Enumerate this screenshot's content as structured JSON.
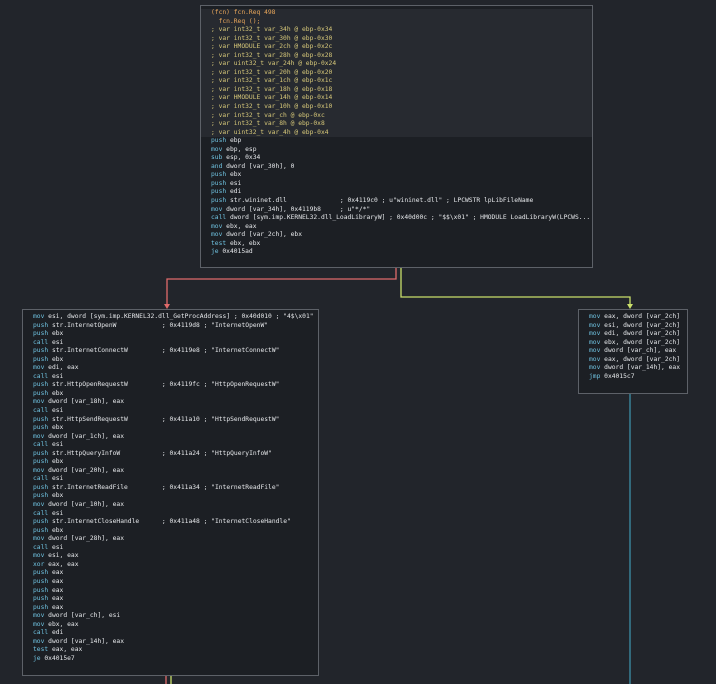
{
  "colors": {
    "true_edge": "#c9df6a",
    "false_edge": "#e06b6b",
    "jump_edge": "#3d8fa8",
    "mnemonic": "#6fc2e0",
    "function_header": "#e8a65a"
  },
  "nodes": {
    "entry": {
      "lines": [
        {
          "t": "(fcn) fcn.Req 498",
          "c": "fn",
          "h": 1
        },
        {
          "t": "  fcn.Req ();",
          "c": "fn",
          "h": 1
        },
        {
          "t": "; var int32_t var_34h @ ebp-0x34",
          "c": "vr",
          "h": 1
        },
        {
          "t": "; var int32_t var_30h @ ebp-0x30",
          "c": "vr",
          "h": 1
        },
        {
          "t": "; var HMODULE var_2ch @ ebp-0x2c",
          "c": "vr",
          "h": 1
        },
        {
          "t": "; var int32_t var_28h @ ebp-0x28",
          "c": "vr",
          "h": 1
        },
        {
          "t": "; var uint32_t var_24h @ ebp-0x24",
          "c": "vr",
          "h": 1
        },
        {
          "t": "; var int32_t var_20h @ ebp-0x20",
          "c": "vr",
          "h": 1
        },
        {
          "t": "; var int32_t var_1ch @ ebp-0x1c",
          "c": "vr",
          "h": 1
        },
        {
          "t": "; var int32_t var_18h @ ebp-0x18",
          "c": "vr",
          "h": 1
        },
        {
          "t": "; var HMODULE var_14h @ ebp-0x14",
          "c": "vr",
          "h": 1
        },
        {
          "t": "; var int32_t var_10h @ ebp-0x10",
          "c": "vr",
          "h": 1
        },
        {
          "t": "; var int32_t var_ch @ ebp-0xc",
          "c": "vr",
          "h": 1
        },
        {
          "t": "; var int32_t var_8h @ ebp-0x8",
          "c": "vr",
          "h": 1
        },
        {
          "t": "; var uint32_t var_4h @ ebp-0x4",
          "c": "vr",
          "h": 1
        },
        {
          "t": "push ebp",
          "c": "kw"
        },
        {
          "t": "mov ebp, esp",
          "c": "kw"
        },
        {
          "t": "sub esp, 0x34",
          "c": "kw"
        },
        {
          "t": "and dword [var_30h], 0",
          "c": "kw"
        },
        {
          "t": "push ebx",
          "c": "kw"
        },
        {
          "t": "push esi",
          "c": "kw"
        },
        {
          "t": "push edi",
          "c": "kw"
        },
        {
          "t": "push str.wininet.dll              ; 0x4119c0 ; u\"wininet.dll\" ; LPCWSTR lpLibFileName",
          "c": "kw"
        },
        {
          "t": "mov dword [var_34h], 0x4119b8     ; u\"*/*\"",
          "c": "kw"
        },
        {
          "t": "call dword [sym.imp.KERNEL32.dll_LoadLibraryW] ; 0x40d00c ; \"$$\\x01\" ; HMODULE LoadLibraryW(LPCWS...",
          "c": "kw"
        },
        {
          "t": "mov ebx, eax",
          "c": "kw"
        },
        {
          "t": "mov dword [var_2ch], ebx",
          "c": "kw"
        },
        {
          "t": "test ebx, ebx",
          "c": "kw"
        },
        {
          "t": "je 0x4015ad",
          "c": "kw"
        }
      ]
    },
    "imports": {
      "lines": [
        {
          "t": "mov esi, dword [sym.imp.KERNEL32.dll_GetProcAddress] ; 0x40d010 ; \"4$\\x01\"",
          "c": "kw"
        },
        {
          "t": "push str.InternetOpenW            ; 0x4119d8 ; \"InternetOpenW\"",
          "c": "kw"
        },
        {
          "t": "push ebx",
          "c": "kw"
        },
        {
          "t": "call esi",
          "c": "kw"
        },
        {
          "t": "push str.InternetConnectW         ; 0x4119e8 ; \"InternetConnectW\"",
          "c": "kw"
        },
        {
          "t": "push ebx",
          "c": "kw"
        },
        {
          "t": "mov edi, eax",
          "c": "kw"
        },
        {
          "t": "call esi",
          "c": "kw"
        },
        {
          "t": "push str.HttpOpenRequestW         ; 0x4119fc ; \"HttpOpenRequestW\"",
          "c": "kw"
        },
        {
          "t": "push ebx",
          "c": "kw"
        },
        {
          "t": "mov dword [var_18h], eax",
          "c": "kw"
        },
        {
          "t": "call esi",
          "c": "kw"
        },
        {
          "t": "push str.HttpSendRequestW         ; 0x411a10 ; \"HttpSendRequestW\"",
          "c": "kw"
        },
        {
          "t": "push ebx",
          "c": "kw"
        },
        {
          "t": "mov dword [var_1ch], eax",
          "c": "kw"
        },
        {
          "t": "call esi",
          "c": "kw"
        },
        {
          "t": "push str.HttpQueryInfoW           ; 0x411a24 ; \"HttpQueryInfoW\"",
          "c": "kw"
        },
        {
          "t": "push ebx",
          "c": "kw"
        },
        {
          "t": "mov dword [var_20h], eax",
          "c": "kw"
        },
        {
          "t": "call esi",
          "c": "kw"
        },
        {
          "t": "push str.InternetReadFile         ; 0x411a34 ; \"InternetReadFile\"",
          "c": "kw"
        },
        {
          "t": "push ebx",
          "c": "kw"
        },
        {
          "t": "mov dword [var_10h], eax",
          "c": "kw"
        },
        {
          "t": "call esi",
          "c": "kw"
        },
        {
          "t": "push str.InternetCloseHandle      ; 0x411a48 ; \"InternetCloseHandle\"",
          "c": "kw"
        },
        {
          "t": "push ebx",
          "c": "kw"
        },
        {
          "t": "mov dword [var_28h], eax",
          "c": "kw"
        },
        {
          "t": "call esi",
          "c": "kw"
        },
        {
          "t": "mov esi, eax",
          "c": "kw"
        },
        {
          "t": "xor eax, eax",
          "c": "kw"
        },
        {
          "t": "push eax",
          "c": "kw"
        },
        {
          "t": "push eax",
          "c": "kw"
        },
        {
          "t": "push eax",
          "c": "kw"
        },
        {
          "t": "push eax",
          "c": "kw"
        },
        {
          "t": "push eax",
          "c": "kw"
        },
        {
          "t": "mov dword [var_ch], esi",
          "c": "kw"
        },
        {
          "t": "mov ebx, eax",
          "c": "kw"
        },
        {
          "t": "call edi",
          "c": "kw"
        },
        {
          "t": "mov dword [var_14h], eax",
          "c": "kw"
        },
        {
          "t": "test eax, eax",
          "c": "kw"
        },
        {
          "t": "je 0x4015e7",
          "c": "kw"
        }
      ]
    },
    "fallback": {
      "lines": [
        {
          "t": "mov eax, dword [var_2ch]",
          "c": "kw"
        },
        {
          "t": "mov esi, dword [var_2ch]",
          "c": "kw"
        },
        {
          "t": "mov edi, dword [var_2ch]",
          "c": "kw"
        },
        {
          "t": "mov ebx, dword [var_2ch]",
          "c": "kw"
        },
        {
          "t": "mov dword [var_ch], eax",
          "c": "kw"
        },
        {
          "t": "mov eax, dword [var_2ch]",
          "c": "kw"
        },
        {
          "t": "mov dword [var_14h], eax",
          "c": "kw"
        },
        {
          "t": "jmp 0x4015c7",
          "c": "kw"
        }
      ]
    }
  }
}
